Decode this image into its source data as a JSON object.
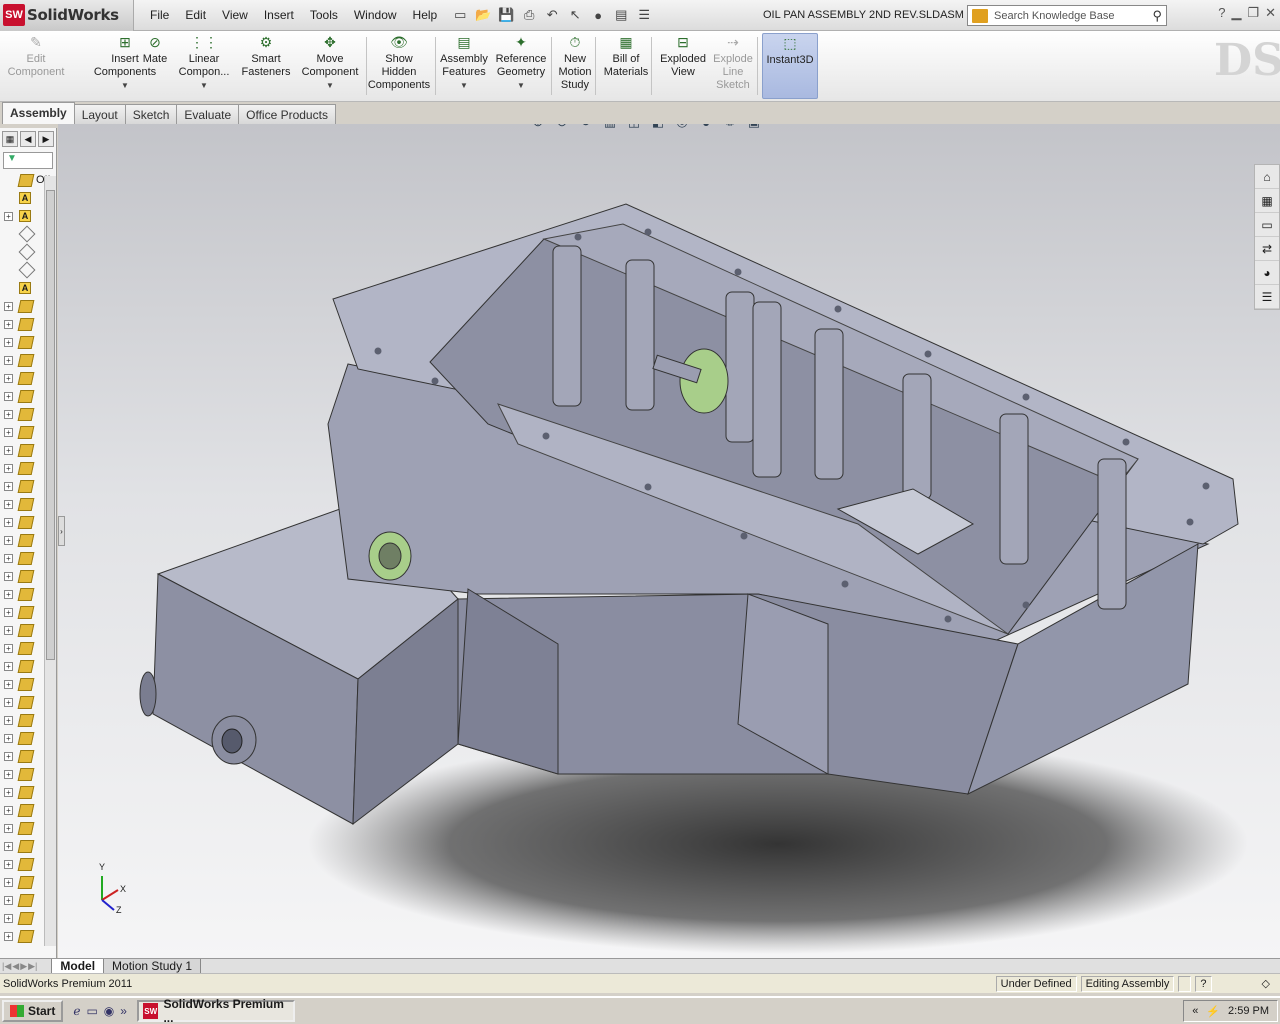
{
  "app": {
    "logo_text": "SolidWorks",
    "document_title": "OIL PAN ASSEMBLY 2ND REV.SLDASM"
  },
  "menu": [
    "File",
    "Edit",
    "View",
    "Insert",
    "Tools",
    "Window",
    "Help"
  ],
  "search": {
    "placeholder": "Search Knowledge Base"
  },
  "commands": [
    {
      "label": "Edit\nComponent",
      "enabled": false,
      "icon": "edit-component-icon"
    },
    {
      "label": "Insert\nComponents",
      "enabled": true,
      "icon": "insert-components-icon"
    },
    {
      "label": "Mate",
      "enabled": true,
      "icon": "mate-icon"
    },
    {
      "label": "Linear\nCompon...",
      "enabled": true,
      "icon": "linear-pattern-icon"
    },
    {
      "label": "Smart\nFasteners",
      "enabled": true,
      "icon": "smart-fasteners-icon"
    },
    {
      "label": "Move\nComponent",
      "enabled": true,
      "icon": "move-component-icon"
    },
    {
      "label": "Show\nHidden\nComponents",
      "enabled": true,
      "icon": "show-hidden-icon"
    },
    {
      "label": "Assembly\nFeatures",
      "enabled": true,
      "icon": "assembly-features-icon"
    },
    {
      "label": "Reference\nGeometry",
      "enabled": true,
      "icon": "reference-geometry-icon"
    },
    {
      "label": "New\nMotion\nStudy",
      "enabled": true,
      "icon": "motion-study-icon"
    },
    {
      "label": "Bill of\nMaterials",
      "enabled": true,
      "icon": "bom-icon"
    },
    {
      "label": "Exploded\nView",
      "enabled": true,
      "icon": "exploded-view-icon"
    },
    {
      "label": "Explode\nLine\nSketch",
      "enabled": false,
      "icon": "explode-line-icon"
    },
    {
      "label": "Instant3D",
      "enabled": true,
      "icon": "instant3d-icon",
      "active": true
    }
  ],
  "tabs": [
    "Assembly",
    "Layout",
    "Sketch",
    "Evaluate",
    "Office Products"
  ],
  "tree": {
    "root_label": "OIL",
    "part_row_count": 36
  },
  "bottom_tabs": [
    "Model",
    "Motion Study 1"
  ],
  "status": {
    "product": "SolidWorks Premium 2011",
    "definition": "Under Defined",
    "mode": "Editing Assembly"
  },
  "taskbar": {
    "start": "Start",
    "task_item": "SolidWorks Premium ...",
    "clock": "2:59 PM"
  },
  "triad": {
    "x": "X",
    "y": "Y",
    "z": "Z"
  },
  "colors": {
    "model_body": "#8f93a8",
    "model_highlight": "#a8ce8a",
    "accent": "#c8102e",
    "instant3d_active": "#b4c3e6"
  }
}
